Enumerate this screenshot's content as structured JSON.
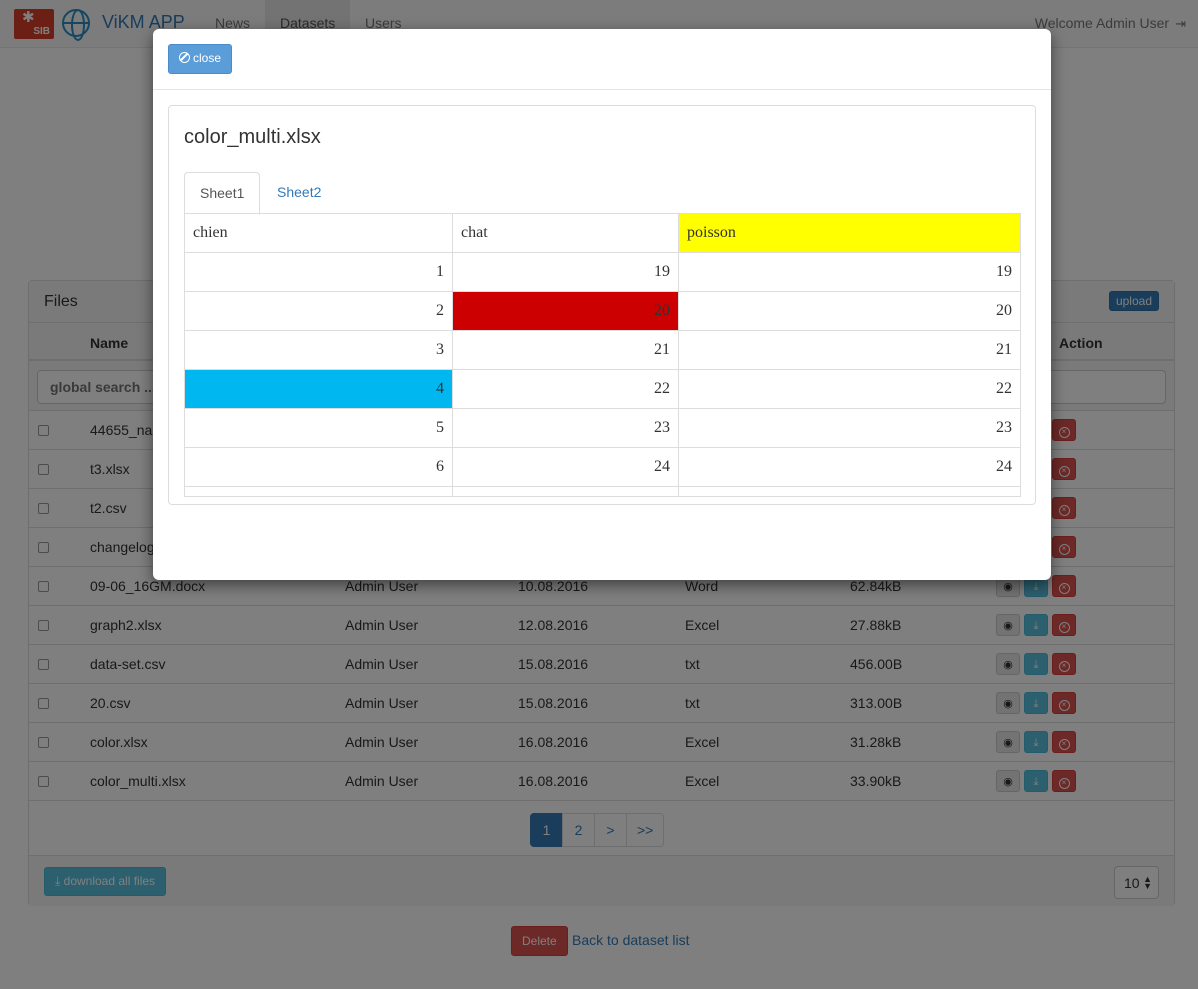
{
  "nav": {
    "logo_text": "SIB",
    "brand": "ViKM APP",
    "items": [
      "News",
      "Datasets",
      "Users"
    ],
    "welcome": "Welcome Admin User"
  },
  "files_panel": {
    "title": "Files",
    "upload_label": "upload",
    "columns": {
      "name": "Name",
      "action": "Action"
    },
    "search_placeholder": "global search ...",
    "rows": [
      {
        "name": "44655_na",
        "owner": "",
        "date": "",
        "type": "",
        "size": ""
      },
      {
        "name": "t3.xlsx",
        "owner": "",
        "date": "",
        "type": "",
        "size": ""
      },
      {
        "name": "t2.csv",
        "owner": "",
        "date": "",
        "type": "",
        "size": ""
      },
      {
        "name": "changelog",
        "owner": "",
        "date": "",
        "type": "",
        "size": ""
      },
      {
        "name": "09-06_16GM.docx",
        "owner": "Admin User",
        "date": "10.08.2016",
        "type": "Word",
        "size": "62.84kB"
      },
      {
        "name": "graph2.xlsx",
        "owner": "Admin User",
        "date": "12.08.2016",
        "type": "Excel",
        "size": "27.88kB"
      },
      {
        "name": "data-set.csv",
        "owner": "Admin User",
        "date": "15.08.2016",
        "type": "txt",
        "size": "456.00B"
      },
      {
        "name": "20.csv",
        "owner": "Admin User",
        "date": "15.08.2016",
        "type": "txt",
        "size": "313.00B"
      },
      {
        "name": "color.xlsx",
        "owner": "Admin User",
        "date": "16.08.2016",
        "type": "Excel",
        "size": "31.28kB"
      },
      {
        "name": "color_multi.xlsx",
        "owner": "Admin User",
        "date": "16.08.2016",
        "type": "Excel",
        "size": "33.90kB"
      }
    ],
    "pagination": [
      "1",
      "2",
      ">",
      ">>"
    ],
    "download_all_label": "download all files",
    "page_size": "10"
  },
  "footer": {
    "delete_label": "Delete",
    "back_label": "Back to dataset list"
  },
  "modal": {
    "close_label": "close",
    "file_title": "color_multi.xlsx",
    "tabs": [
      "Sheet1",
      "Sheet2"
    ],
    "active_tab": "Sheet1",
    "sheet": {
      "header": [
        "chien",
        "chat",
        "poisson"
      ],
      "rows": [
        [
          "1",
          "19",
          "19"
        ],
        [
          "2",
          "20",
          "20"
        ],
        [
          "3",
          "21",
          "21"
        ],
        [
          "4",
          "22",
          "22"
        ],
        [
          "5",
          "23",
          "23"
        ],
        [
          "6",
          "24",
          "24"
        ]
      ],
      "highlight_colors": {
        "poisson_header": "#ffff00",
        "chat_row2": "#cc0000",
        "chien_row4": "#00b7f0"
      }
    }
  }
}
